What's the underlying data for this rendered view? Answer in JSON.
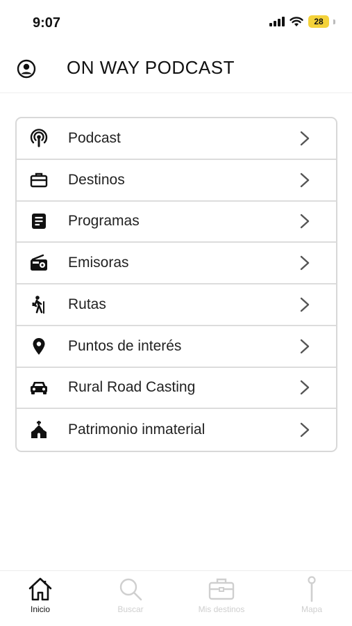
{
  "status_bar": {
    "time": "9:07",
    "battery": "28"
  },
  "header": {
    "title": "ON WAY PODCAST",
    "profile_icon": "account-circle-icon"
  },
  "menu": {
    "items": [
      {
        "label": "Podcast",
        "icon": "podcast-icon"
      },
      {
        "label": "Destinos",
        "icon": "briefcase-icon"
      },
      {
        "label": "Programas",
        "icon": "document-icon"
      },
      {
        "label": "Emisoras",
        "icon": "radio-icon"
      },
      {
        "label": "Rutas",
        "icon": "hiker-icon"
      },
      {
        "label": "Puntos de interés",
        "icon": "map-pin-icon"
      },
      {
        "label": "Rural Road Casting",
        "icon": "car-icon"
      },
      {
        "label": "Patrimonio inmaterial",
        "icon": "church-icon"
      }
    ]
  },
  "tab_bar": {
    "tabs": [
      {
        "label": "Inicio",
        "icon": "home-icon",
        "active": true
      },
      {
        "label": "Buscar",
        "icon": "search-icon",
        "active": false
      },
      {
        "label": "Mis destinos",
        "icon": "briefcase-icon",
        "active": false
      },
      {
        "label": "Mapa",
        "icon": "pin-icon",
        "active": false
      }
    ]
  },
  "colors": {
    "active": "#111111",
    "inactive": "#cfcfcf",
    "divider": "#dcdcdc",
    "battery": "#f4d23a"
  }
}
